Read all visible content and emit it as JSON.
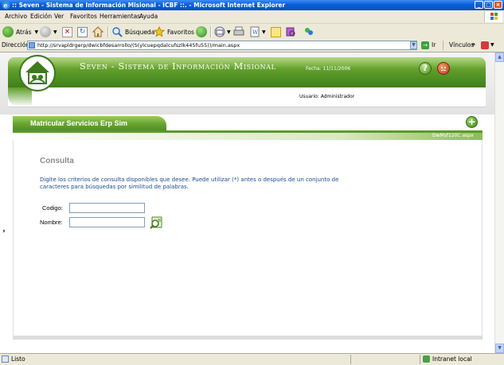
{
  "window": {
    "title": ":: Seven - Sistema de Información Misional - ICBF ::. - Microsoft Internet Explorer"
  },
  "menu": {
    "items": [
      "Archivo",
      "Edición",
      "Ver",
      "Favoritos",
      "Herramientas",
      "Ayuda"
    ]
  },
  "toolbar": {
    "back_label": "Atrás",
    "search_label": "Búsqueda",
    "favorites_label": "Favoritos"
  },
  "address": {
    "label": "Dirección",
    "url": "http://srvapldrgerp/dwicbfdesarrollo/(S(ylcuepqdalcufszlk445fu55))/main.aspx",
    "go_label": "Ir",
    "links_label": "Vínculos"
  },
  "header": {
    "app_title": "Seven - Sistema de Información Misional",
    "fecha": "Fecha: 11/11/2006",
    "usuario": "Usuario: Administrador"
  },
  "section": {
    "title": "Matricular Servicios Erp Sim",
    "file_name": "DwMsf120C.aspx"
  },
  "form": {
    "heading": "Consulta",
    "instructions": "Digite los criterios de consulta disponibles que desee. Puede utilizar (*) antes o después de un conjunto de caracteres para búsquedas por similitud de palabras.",
    "codigo_label": "Codigo:",
    "codigo_value": "",
    "nombre_label": "Nombre:",
    "nombre_value": ""
  },
  "status": {
    "left": "Listo",
    "zone": "Intranet local"
  },
  "colors": {
    "header_green": "#5e9d2a",
    "instruction_blue": "#1a4a8c",
    "xp_title_blue": "#0a5ed8"
  }
}
